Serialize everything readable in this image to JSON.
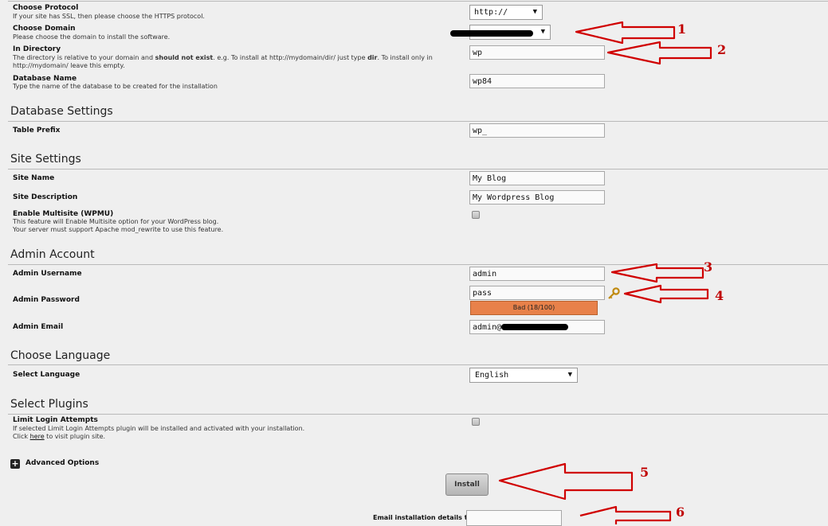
{
  "protocol": {
    "label": "Choose Protocol",
    "hint": "If your site has SSL, then please choose the HTTPS protocol.",
    "value": "http://"
  },
  "domain": {
    "label": "Choose Domain",
    "hint": "Please choose the domain to install the software."
  },
  "directory": {
    "label": "In Directory",
    "hint_part1": "The directory is relative to your domain and ",
    "hint_bold1": "should not exist",
    "hint_part2": ". e.g. To install at http://mydomain/dir/ just type ",
    "hint_bold2": "dir",
    "hint_part3": ". To install only in",
    "hint_line2": "http://mydomain/ leave this empty.",
    "value": "wp"
  },
  "db_name": {
    "label": "Database Name",
    "hint": "Type the name of the database to be created for the installation",
    "value": "wp84"
  },
  "sections": {
    "database": "Database Settings",
    "site": "Site Settings",
    "admin": "Admin Account",
    "language": "Choose Language",
    "plugins": "Select Plugins"
  },
  "table_prefix": {
    "label": "Table Prefix",
    "value": "wp_"
  },
  "site_name": {
    "label": "Site Name",
    "value": "My Blog"
  },
  "site_desc": {
    "label": "Site Description",
    "value": "My Wordpress Blog"
  },
  "multisite": {
    "label": "Enable Multisite (WPMU)",
    "hint1": "This feature will Enable Multisite option for your WordPress blog.",
    "hint2": "Your server must support Apache mod_rewrite to use this feature."
  },
  "admin_user": {
    "label": "Admin Username",
    "value": "admin"
  },
  "admin_pass": {
    "label": "Admin Password",
    "value": "pass",
    "strength": "Bad (18/100)",
    "strength_color": "#e8814a"
  },
  "admin_email": {
    "label": "Admin Email",
    "value": "admin@"
  },
  "language": {
    "label": "Select Language",
    "value": "English"
  },
  "limit_login": {
    "label": "Limit Login Attempts",
    "hint1": "If selected Limit Login Attempts plugin will be installed and activated with your installation.",
    "hint2_pre": "Click ",
    "hint2_link": "here",
    "hint2_post": " to visit plugin site."
  },
  "advanced": {
    "label": "Advanced Options",
    "icon": "plus-icon"
  },
  "install": {
    "label": "Install"
  },
  "email_details": {
    "label": "Email installation details to :"
  },
  "annotations": [
    "1",
    "2",
    "3",
    "4",
    "5",
    "6"
  ],
  "colors": {
    "arrow": "#d00000",
    "number": "#c00000"
  }
}
